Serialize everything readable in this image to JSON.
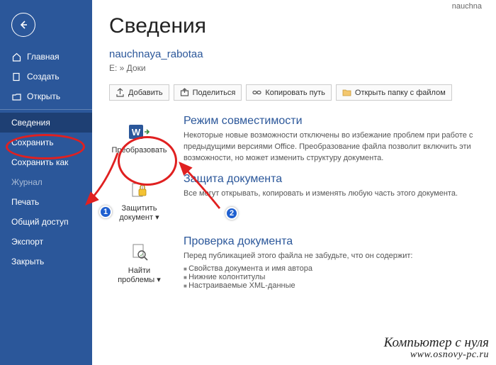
{
  "top_label": "nauchna",
  "sidebar": {
    "items": [
      {
        "label": "Главная",
        "icon": "home-icon"
      },
      {
        "label": "Создать",
        "icon": "new-icon"
      },
      {
        "label": "Открыть",
        "icon": "open-icon"
      },
      {
        "label": "Сведения",
        "selected": true
      },
      {
        "label": "Сохранить"
      },
      {
        "label": "Сохранить как"
      },
      {
        "label": "Журнал",
        "disabled": true
      },
      {
        "label": "Печать"
      },
      {
        "label": "Общий доступ"
      },
      {
        "label": "Экспорт"
      },
      {
        "label": "Закрыть"
      }
    ]
  },
  "page": {
    "title": "Сведения",
    "doc_name": "nauchnaya_rabotaa",
    "doc_path": "E: » Доки"
  },
  "toolbar": {
    "add": "Добавить",
    "share": "Поделиться",
    "copy_path": "Копировать путь",
    "open_folder": "Открыть папку с файлом"
  },
  "sections": {
    "compat": {
      "btn": "Преобразовать",
      "title": "Режим совместимости",
      "desc": "Некоторые новые возможности отключены во избежание проблем при работе с предыдущими версиями Office. Преобразование файла позволит включить эти возможности, но может изменить структуру документа."
    },
    "protect": {
      "btn": "Защитить документ ▾",
      "title": "Защита документа",
      "desc": "Все могут открывать, копировать и изменять любую часть этого документа."
    },
    "inspect": {
      "btn": "Найти проблемы ▾",
      "title": "Проверка документа",
      "desc": "Перед публикацией этого файла не забудьте, что он содержит:",
      "bullets": [
        "Свойства документа и имя автора",
        "Нижние колонтитулы",
        "Настраиваемые XML-данные"
      ]
    }
  },
  "annotations": {
    "badge1": "1",
    "badge2": "2"
  },
  "watermark": {
    "l1": "Компьютер с нуля",
    "l2": "www.osnovy-pc.ru"
  }
}
